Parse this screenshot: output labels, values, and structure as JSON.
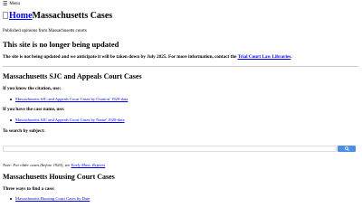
{
  "menu": {
    "icon": "hamburger-icon",
    "label": "Menu"
  },
  "header": {
    "logo_alt": "Home",
    "title": "Massachusetts Cases",
    "tagline": "Published opinions from Massachusetts courts"
  },
  "alert": {
    "heading": "This site is no longer being updated",
    "text": "The site is not being updated and we anticipate it will be taken down by July 2025. For more information, contact the",
    "link_text": "Trial Court Law Libraries",
    "suffix": "."
  },
  "sjc": {
    "title": "Massachusetts SJC and Appeals Court Cases",
    "citation_heading": "If you know the citation, use:",
    "citation_link": "Massachusetts SJC and Appeals Court Cases by Citation' 1920-data",
    "name_heading": "If you have the case name, use:",
    "name_link": "Massachusetts SJC and Appeals Court Cases by Name' 1920-data",
    "subject_heading": "To search by subject:"
  },
  "search": {
    "placeholder": "",
    "button_icon": "search-icon",
    "accent": "#4a8fe7"
  },
  "note": {
    "prefix": "Note: For older cases (before 1920), see",
    "link_text": "Early Mass. Reports"
  },
  "housing": {
    "title": "Massachusetts Housing Court Cases",
    "sub_heading": "Three ways to find a case:",
    "link": "Massachusetts Housing Court Cases by Date"
  }
}
